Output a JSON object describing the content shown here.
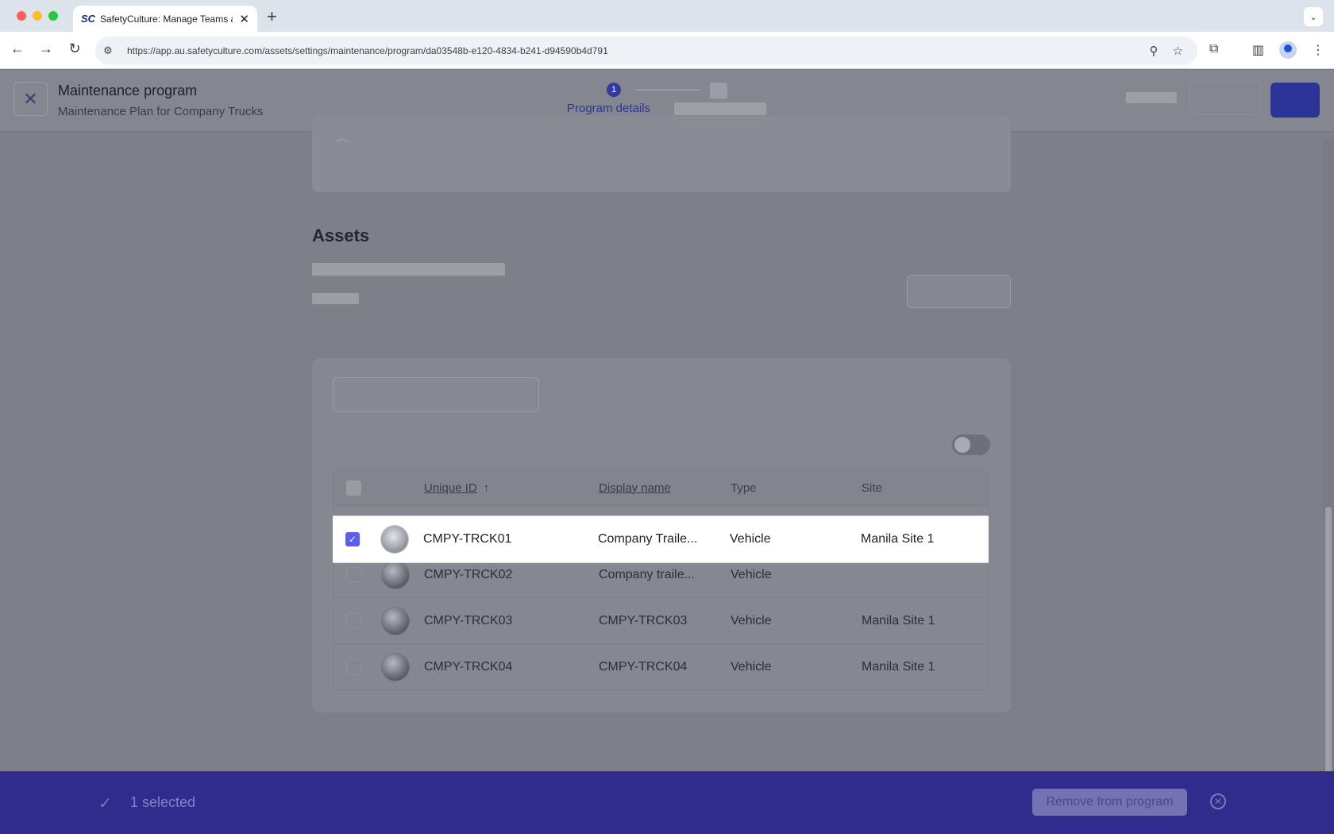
{
  "browser": {
    "tab_title": "SafetyCulture: Manage Teams and...",
    "tab_favicon": "SC",
    "url": "https://app.au.safetyculture.com/assets/settings/maintenance/program/da03548b-e120-4834-b241-d94590b4d791"
  },
  "header": {
    "title": "Maintenance program",
    "subtitle": "Maintenance Plan for Company Trucks",
    "step_number": "1",
    "step_label": "Program details"
  },
  "assets_section": {
    "heading": "Assets"
  },
  "table": {
    "columns": {
      "unique_id": "Unique ID",
      "display_name": "Display name",
      "type": "Type",
      "site": "Site"
    },
    "rows": [
      {
        "unique_id": "CMPY-TRCK01",
        "display_name": "Company Traile...",
        "type": "Vehicle",
        "site": "Manila Site 1",
        "selected": true
      },
      {
        "unique_id": "CMPY-TRCK02",
        "display_name": "Company traile...",
        "type": "Vehicle",
        "site": "",
        "selected": false
      },
      {
        "unique_id": "CMPY-TRCK03",
        "display_name": "CMPY-TRCK03",
        "type": "Vehicle",
        "site": "Manila Site 1",
        "selected": false
      },
      {
        "unique_id": "CMPY-TRCK04",
        "display_name": "CMPY-TRCK04",
        "type": "Vehicle",
        "site": "Manila Site 1",
        "selected": false
      }
    ]
  },
  "bulk_bar": {
    "selected_text": "1 selected",
    "remove_label": "Remove from program"
  },
  "colors": {
    "accent": "#2f2c8e",
    "checkbox_checked": "#5a5ff0"
  }
}
